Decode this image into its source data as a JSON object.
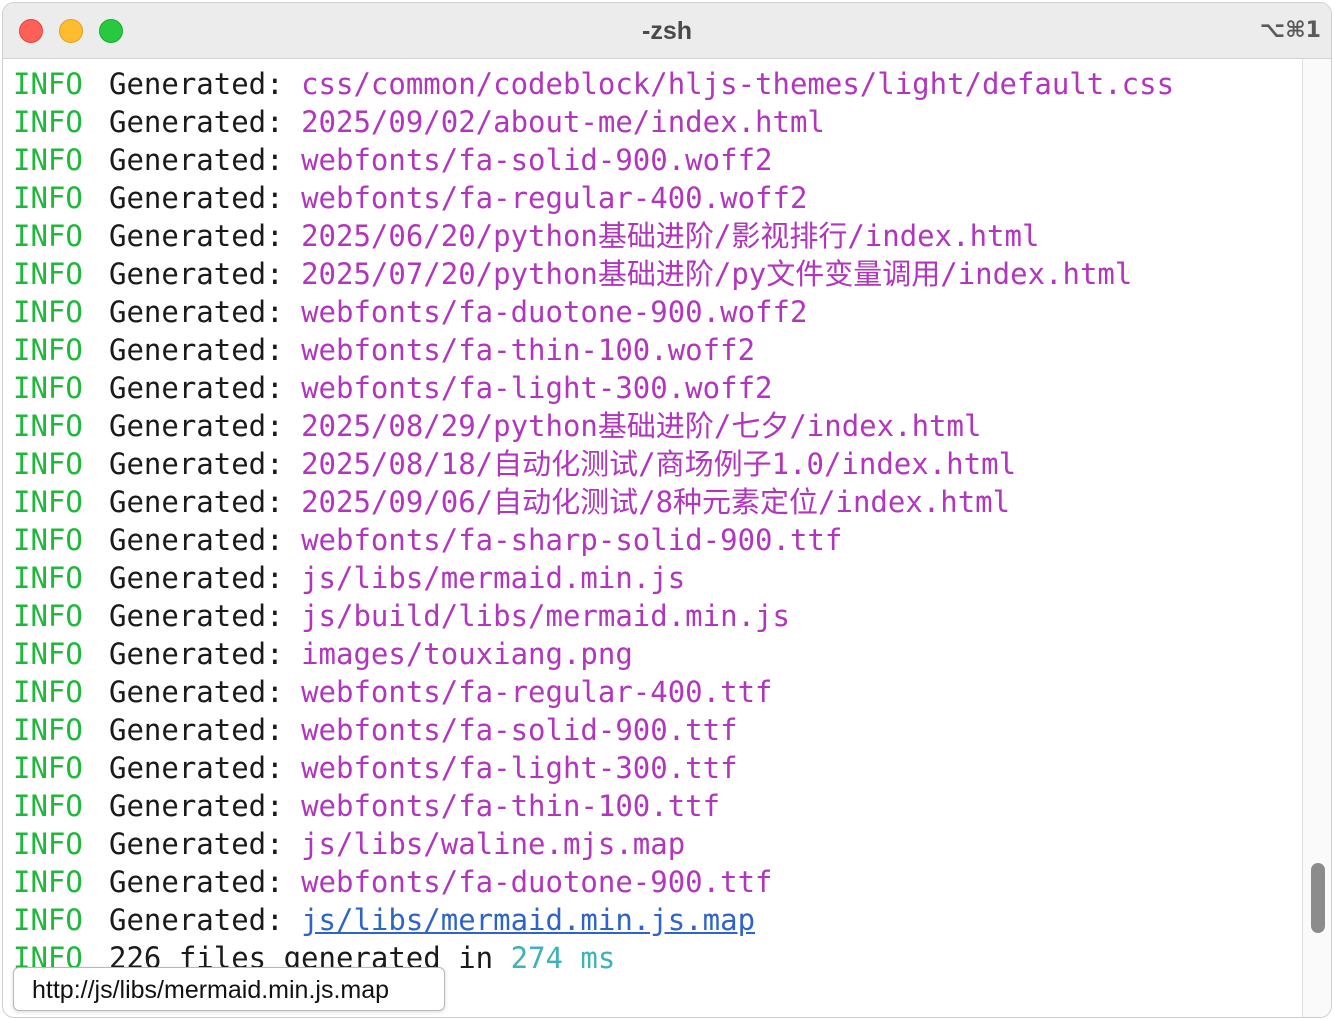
{
  "window": {
    "title": "-zsh",
    "shortcut": "⌥⌘1"
  },
  "log": [
    {
      "level": "INFO",
      "message": "Generated:",
      "path": "css/common/codeblock/hljs-themes/light/default.css"
    },
    {
      "level": "INFO",
      "message": "Generated:",
      "path": "2025/09/02/about-me/index.html"
    },
    {
      "level": "INFO",
      "message": "Generated:",
      "path": "webfonts/fa-solid-900.woff2"
    },
    {
      "level": "INFO",
      "message": "Generated:",
      "path": "webfonts/fa-regular-400.woff2"
    },
    {
      "level": "INFO",
      "message": "Generated:",
      "path": "2025/06/20/python基础进阶/影视排行/index.html"
    },
    {
      "level": "INFO",
      "message": "Generated:",
      "path": "2025/07/20/python基础进阶/py文件变量调用/index.html"
    },
    {
      "level": "INFO",
      "message": "Generated:",
      "path": "webfonts/fa-duotone-900.woff2"
    },
    {
      "level": "INFO",
      "message": "Generated:",
      "path": "webfonts/fa-thin-100.woff2"
    },
    {
      "level": "INFO",
      "message": "Generated:",
      "path": "webfonts/fa-light-300.woff2"
    },
    {
      "level": "INFO",
      "message": "Generated:",
      "path": "2025/08/29/python基础进阶/七夕/index.html"
    },
    {
      "level": "INFO",
      "message": "Generated:",
      "path": "2025/08/18/自动化测试/商场例子1.0/index.html"
    },
    {
      "level": "INFO",
      "message": "Generated:",
      "path": "2025/09/06/自动化测试/8种元素定位/index.html"
    },
    {
      "level": "INFO",
      "message": "Generated:",
      "path": "webfonts/fa-sharp-solid-900.ttf"
    },
    {
      "level": "INFO",
      "message": "Generated:",
      "path": "js/libs/mermaid.min.js"
    },
    {
      "level": "INFO",
      "message": "Generated:",
      "path": "js/build/libs/mermaid.min.js"
    },
    {
      "level": "INFO",
      "message": "Generated:",
      "path": "images/touxiang.png"
    },
    {
      "level": "INFO",
      "message": "Generated:",
      "path": "webfonts/fa-regular-400.ttf"
    },
    {
      "level": "INFO",
      "message": "Generated:",
      "path": "webfonts/fa-solid-900.ttf"
    },
    {
      "level": "INFO",
      "message": "Generated:",
      "path": "webfonts/fa-light-300.ttf"
    },
    {
      "level": "INFO",
      "message": "Generated:",
      "path": "webfonts/fa-thin-100.ttf"
    },
    {
      "level": "INFO",
      "message": "Generated:",
      "path": "js/libs/waline.mjs.map"
    },
    {
      "level": "INFO",
      "message": "Generated:",
      "path": "webfonts/fa-duotone-900.ttf"
    },
    {
      "level": "INFO",
      "message": "Generated:",
      "path": "js/libs/mermaid.min.js.map"
    }
  ],
  "summary": {
    "level": "INFO",
    "message": "226 files generated in",
    "time": "274 ms"
  },
  "tooltip": "http://js/libs/mermaid.min.js.map",
  "colors": {
    "level": "#1fb83b",
    "path": "#b135bd",
    "link": "#2e63c9",
    "time": "#3fb1bb"
  }
}
